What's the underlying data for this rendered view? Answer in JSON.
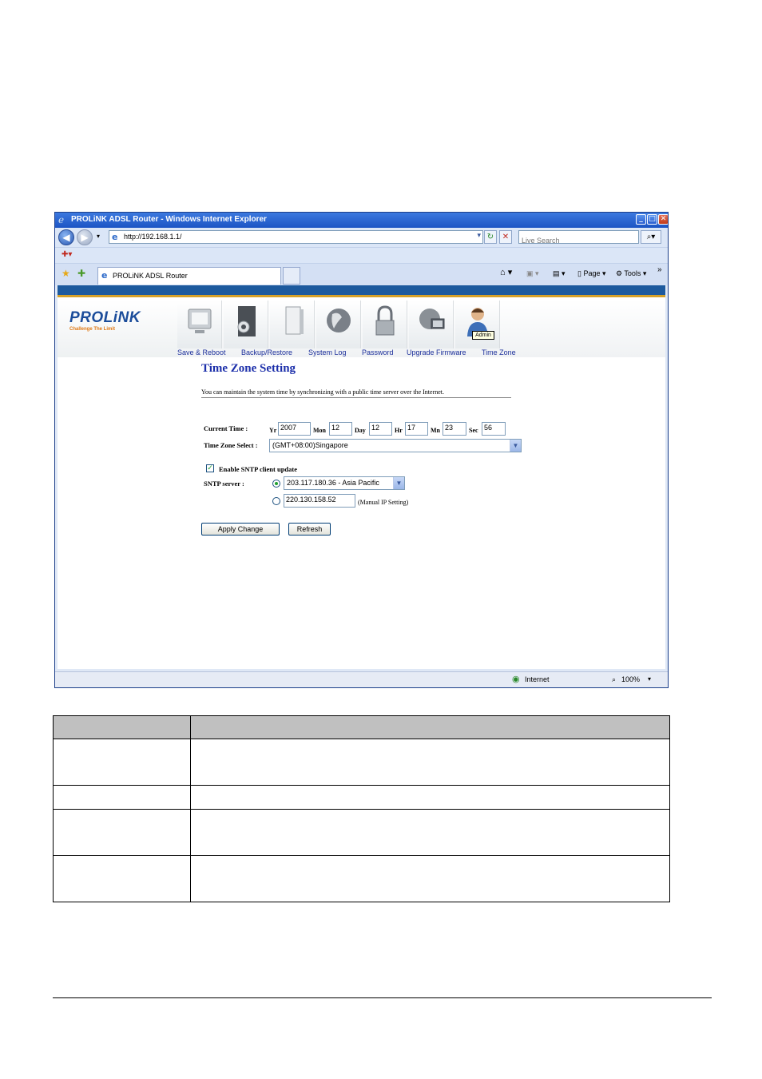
{
  "window": {
    "title": "PROLiNK ADSL Router - Windows Internet Explorer",
    "url": "http://192.168.1.1/",
    "search_placeholder": "Live Search",
    "tab_label": "PROLiNK ADSL Router",
    "page_menu": "Page",
    "tools_menu": "Tools",
    "chevron": "»"
  },
  "header": {
    "logo": "PROLiNK",
    "tagline": "Challenge The Limit",
    "admin_tooltip": "Admin",
    "menu": [
      {
        "label": "Save & Reboot",
        "icon": "monitor-icon"
      },
      {
        "label": "Backup/Restore",
        "icon": "gear-box-icon"
      },
      {
        "label": "System Log",
        "icon": "server-icon"
      },
      {
        "label": "Password",
        "icon": "globe-icon"
      },
      {
        "label": "Upgrade Firmware",
        "icon": "lock-icon"
      },
      {
        "label": "Time Zone",
        "icon": "globe-computer-icon"
      }
    ]
  },
  "page": {
    "title": "Time Zone Setting",
    "description": "You can maintain the system time by synchronizing with a public time server over the Internet.",
    "current_time_label": "Current Time :",
    "units": {
      "yr": "Yr",
      "mon": "Mon",
      "day": "Day",
      "hr": "Hr",
      "mn": "Mn",
      "sec": "Sec"
    },
    "time": {
      "yr": "2007",
      "mon": "12",
      "day": "12",
      "hr": "17",
      "mn": "23",
      "sec": "56"
    },
    "time_zone_label": "Time Zone Select :",
    "time_zone_value": "(GMT+08:00)Singapore",
    "enable_sntp_label": "Enable SNTP client update",
    "sntp_server_label": "SNTP server :",
    "sntp_option_1": "203.117.180.36 - Asia Pacific",
    "sntp_option_2": "220.130.158.52",
    "manual_ip_note": "(Manual IP Setting)",
    "apply_button": "Apply Change",
    "refresh_button": "Refresh"
  },
  "status": {
    "zone": "Internet",
    "zoom": "100%"
  }
}
